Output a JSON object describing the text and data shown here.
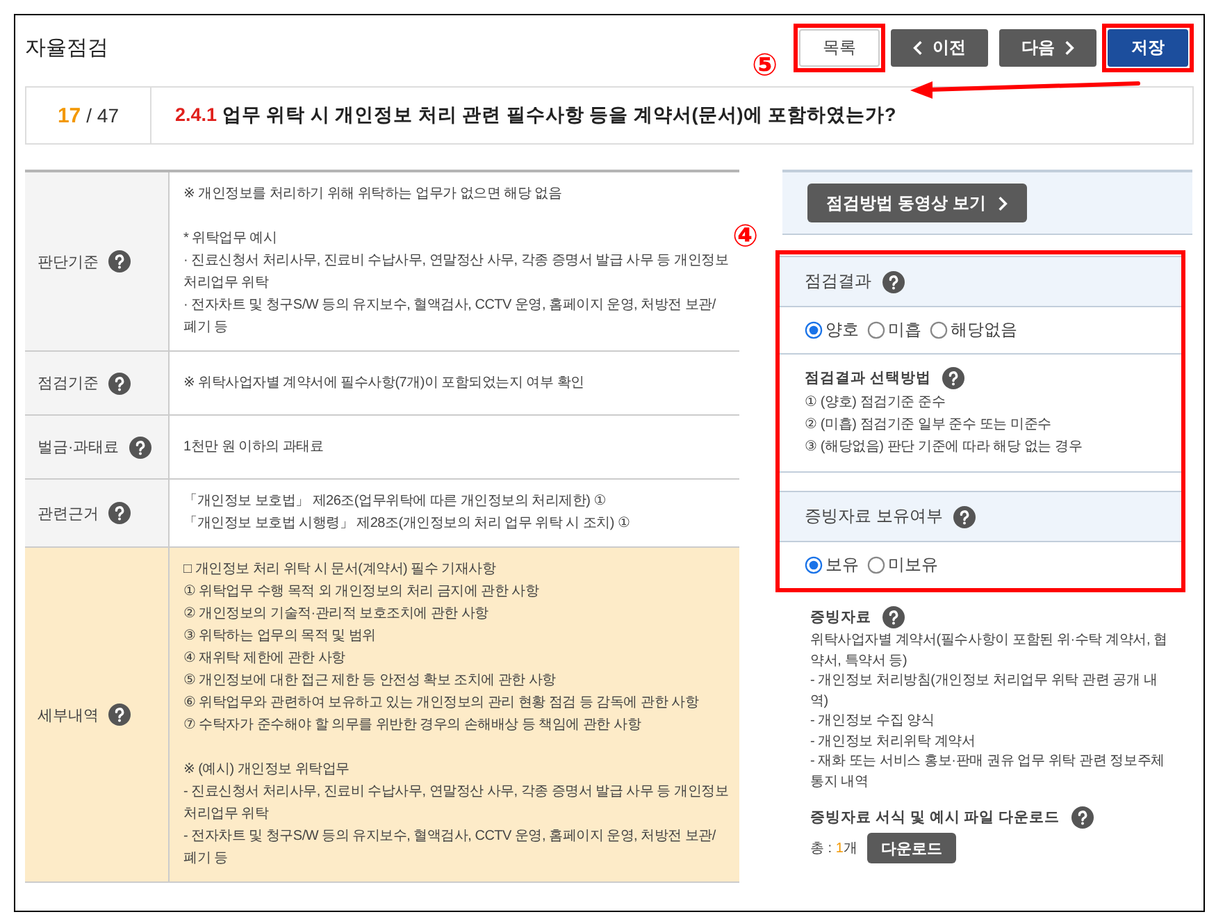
{
  "header": {
    "title": "자율점검",
    "callout": "⑤",
    "buttons": [
      {
        "label": "목록",
        "kind": "list",
        "highlighted": true
      },
      {
        "label": "이전",
        "kind": "prev",
        "highlighted": false
      },
      {
        "label": "다음",
        "kind": "next",
        "highlighted": false
      },
      {
        "label": "저장",
        "kind": "save",
        "highlighted": true
      }
    ]
  },
  "question": {
    "current": "17",
    "total": "/ 47",
    "number": "2.4.1",
    "text": "업무 위탁 시 개인정보 처리 관련 필수사항 등을 계약서(문서)에 포함하였는가?"
  },
  "criteria_table": {
    "rows": [
      {
        "label": "판단기준",
        "highlighted": false,
        "blocks": [
          [
            "※ 개인정보를 처리하기 위해 위탁하는 업무가 없으면 해당 없음"
          ],
          [
            "* 위탁업무 예시",
            "· 진료신청서 처리사무, 진료비 수납사무, 연말정산 사무, 각종 증명서 발급 사무 등 개인정보 처리업무 위탁",
            "· 전자차트 및 청구S/W 등의 유지보수, 혈액검사, CCTV 운영, 홈페이지 운영, 처방전 보관/폐기 등"
          ]
        ]
      },
      {
        "label": "점검기준",
        "highlighted": false,
        "blocks": [
          [
            "※ 위탁사업자별 계약서에 필수사항(7개)이 포함되었는지 여부 확인"
          ]
        ]
      },
      {
        "label": "벌금·과태료",
        "highlighted": false,
        "blocks": [
          [
            "1천만 원 이하의 과태료"
          ]
        ]
      },
      {
        "label": "관련근거",
        "highlighted": false,
        "blocks": [
          [
            "「개인정보 보호법」 제26조(업무위탁에 따른 개인정보의 처리제한) ①",
            "「개인정보 보호법 시행령」 제28조(개인정보의 처리 업무 위탁 시 조치) ①"
          ]
        ]
      },
      {
        "label": "세부내역",
        "highlighted": true,
        "blocks": [
          [
            "□ 개인정보 처리 위탁 시 문서(계약서) 필수 기재사항",
            "① 위탁업무 수행 목적 외 개인정보의 처리 금지에 관한 사항",
            "② 개인정보의 기술적·관리적 보호조치에 관한 사항",
            "③ 위탁하는 업무의 목적 및 범위",
            "④ 재위탁 제한에 관한 사항",
            "⑤ 개인정보에 대한 접근 제한 등 안전성 확보 조치에 관한 사항",
            "⑥ 위탁업무와 관련하여 보유하고 있는 개인정보의 관리 현황 점검 등 감독에 관한 사항",
            "⑦ 수탁자가 준수해야 할 의무를 위반한 경우의 손해배상 등 책임에 관한 사항"
          ],
          [
            "※ (예시) 개인정보 위탁업무",
            "- 진료신청서 처리사무, 진료비 수납사무, 연말정산 사무, 각종 증명서 발급 사무 등 개인정보 처리업무 위탁",
            "- 전자차트 및 청구S/W 등의 유지보수, 혈액검사, CCTV 운영, 홈페이지 운영, 처방전 보관/폐기 등"
          ]
        ]
      }
    ]
  },
  "video_button": {
    "label": "점검방법 동영상 보기"
  },
  "result_panel": {
    "highlighted": true,
    "callout": "④",
    "result": {
      "title": "점검결과",
      "options": [
        {
          "label": "양호",
          "selected": true
        },
        {
          "label": "미흡",
          "selected": false
        },
        {
          "label": "해당없음",
          "selected": false
        }
      ]
    },
    "method": {
      "title": "점검결과 선택방법",
      "lines": [
        "① (양호) 점검기준 준수",
        "② (미흡) 점검기준 일부 준수 또는 미준수",
        "③ (해당없음) 판단 기준에 따라 해당 없는 경우"
      ]
    },
    "possession": {
      "title": "증빙자료 보유여부",
      "options": [
        {
          "label": "보유",
          "selected": true
        },
        {
          "label": "미보유",
          "selected": false
        }
      ]
    }
  },
  "evidence": {
    "title": "증빙자료",
    "lines": [
      "위탁사업자별 계약서(필수사항이 포함된 위·수탁 계약서, 협약서, 특약서 등)",
      "- 개인정보 처리방침(개인정보 처리업무 위탁 관련 공개 내역)",
      "- 개인정보 수집 양식",
      "- 개인정보 처리위탁 계약서",
      "- 재화 또는 서비스 홍보·판매 권유 업무 위탁 관련 정보주체 통지 내역"
    ]
  },
  "download": {
    "title": "증빙자료 서식 및 예시 파일 다운로드",
    "count_prefix": "총 :",
    "count": "1",
    "count_unit": "개",
    "button": "다운로드"
  }
}
